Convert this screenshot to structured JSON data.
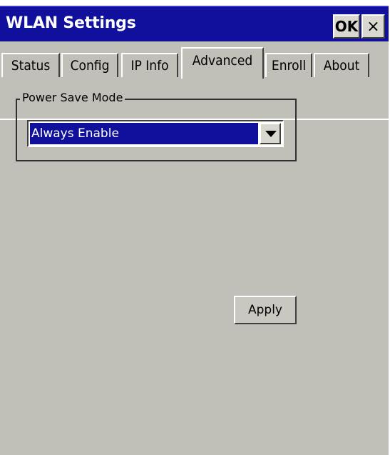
{
  "window": {
    "title": "WLAN Settings"
  },
  "titlebar": {
    "ok_label": "OK",
    "close_label": "×"
  },
  "tabs": [
    {
      "label": "Status",
      "active": false
    },
    {
      "label": "Config",
      "active": false
    },
    {
      "label": "IP Info",
      "active": false
    },
    {
      "label": "Advanced",
      "active": true
    },
    {
      "label": "Enroll",
      "active": false
    },
    {
      "label": "About",
      "active": false
    }
  ],
  "power_save": {
    "group_label": "Power Save Mode",
    "selected_value": "Always Enable"
  },
  "actions": {
    "apply_label": "Apply"
  },
  "colors": {
    "titlebar": "#10109c",
    "window_bg": "#c0c0b8",
    "selection": "#10109c"
  }
}
